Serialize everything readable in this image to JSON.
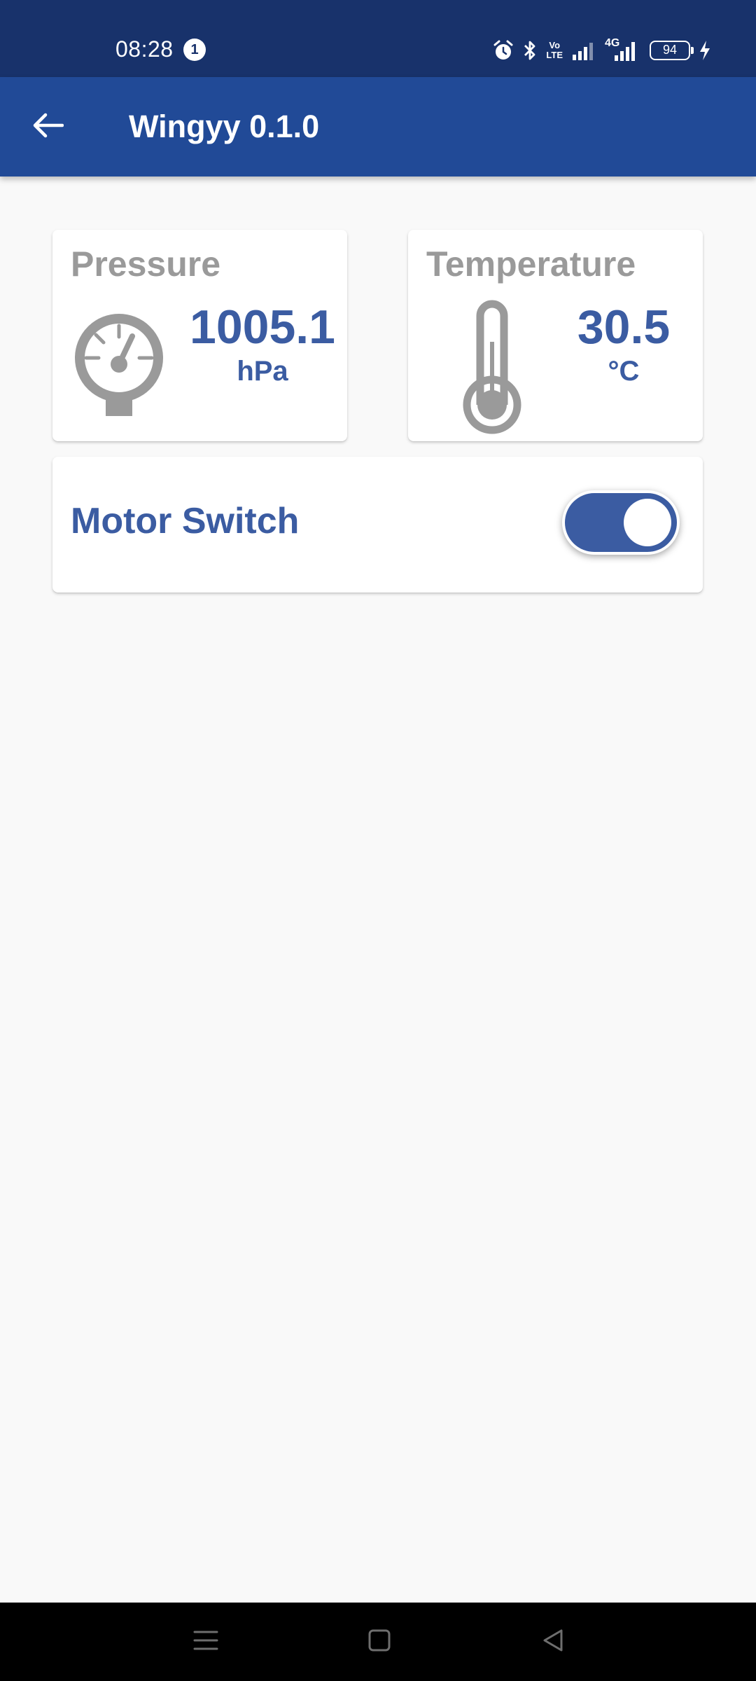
{
  "status_bar": {
    "time": "08:28",
    "notification_count": "1",
    "volte_line1": "Vo",
    "volte_line2": "LTE",
    "network_label": "4G",
    "battery_level": "94"
  },
  "app_bar": {
    "title": "Wingyy 0.1.0"
  },
  "pressure_card": {
    "title": "Pressure",
    "value": "1005.1",
    "unit": "hPa",
    "icon": "gauge-icon"
  },
  "temperature_card": {
    "title": "Temperature",
    "value": "30.5",
    "unit": "°C",
    "icon": "thermometer-icon"
  },
  "motor_card": {
    "label": "Motor Switch",
    "switch_on": true
  },
  "colors": {
    "status_bar": "#18326b",
    "app_bar": "#214a97",
    "accent": "#3b5ca2",
    "label_gray": "#9a9a9a",
    "background": "#f9f9f9"
  }
}
